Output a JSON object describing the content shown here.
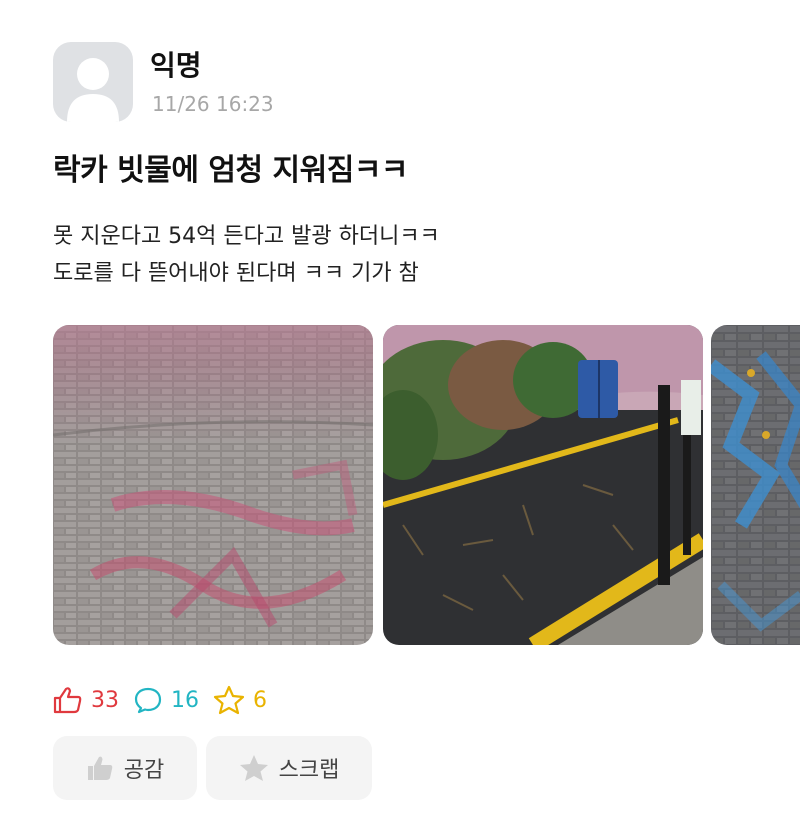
{
  "post": {
    "author": "익명",
    "time": "11/26 16:23",
    "title": "락카 빗물에 엄청 지워짐ㅋㅋ",
    "body_lines": [
      "못 지운다고 54억 든다고 발광 하더니ㅋㅋ",
      "도로를 다 뜯어내야 된다며 ㅋㅋ 기가 참"
    ]
  },
  "images": [
    {
      "icon": "photo-brick-plaza-pink-spray"
    },
    {
      "icon": "photo-asphalt-path-yellow-line"
    },
    {
      "icon": "photo-brick-blue-spray-partial"
    }
  ],
  "stats": {
    "likes": "33",
    "comments": "16",
    "scraps": "6"
  },
  "buttons": {
    "empathy": "공감",
    "scrap": "스크랩"
  },
  "colors": {
    "like": "#e0393e",
    "comment": "#22b5c3",
    "scrap": "#e9b300",
    "button_bg": "#f4f4f4"
  }
}
